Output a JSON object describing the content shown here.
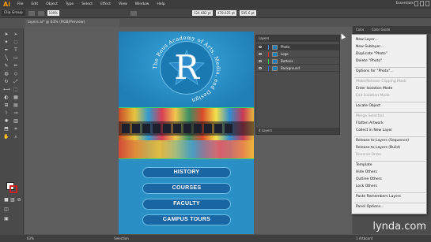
{
  "app": {
    "logo": "Ai",
    "menus": [
      "File",
      "Edit",
      "Object",
      "Type",
      "Select",
      "Effect",
      "View",
      "Window",
      "Help"
    ],
    "workspace": "Essentials"
  },
  "control_bar": {
    "selection_label": "Clip Group",
    "opacity": "100%",
    "x": "524.682 pt",
    "y": "478.025 pt",
    "w": "585.6 pt"
  },
  "document": {
    "tab_title": "layers.ai* @ 63% (RGB/Preview)",
    "zoom": "63%",
    "status_tool": "Selection"
  },
  "artwork": {
    "logo_letter": "R",
    "logo_ring_text": "The Rous Academy of Arts, Media, and Design",
    "buttons": [
      "HISTORY",
      "COURSES",
      "FACULTY",
      "CAMPUS TOURS"
    ],
    "button_color": "#1966a4",
    "background_color": "#2a8fc4"
  },
  "layers_panel": {
    "title": "Layers",
    "layers": [
      {
        "name": "Photo",
        "color": "#4f8ff5",
        "active": true
      },
      {
        "name": "Logo",
        "color": "#e23434",
        "active": false
      },
      {
        "name": "Buttons",
        "color": "#3cc24f",
        "active": false
      },
      {
        "name": "Background",
        "color": "#3a6cf0",
        "active": false
      }
    ],
    "footer": "4 Layers"
  },
  "color_panel": {
    "tabs": [
      "Color",
      "Color Guide"
    ]
  },
  "flyout_menu": {
    "items": [
      {
        "label": "New Layer...",
        "enabled": true
      },
      {
        "label": "New Sublayer...",
        "enabled": true
      },
      {
        "label": "Duplicate \"Photo\"",
        "enabled": true
      },
      {
        "label": "Delete \"Photo\"",
        "enabled": true
      },
      {
        "label": "Options for \"Photo\"...",
        "enabled": true
      },
      {
        "label": "Make/Release Clipping Mask",
        "enabled": false
      },
      {
        "label": "Enter Isolation Mode",
        "enabled": true
      },
      {
        "label": "Exit Isolation Mode",
        "enabled": false
      },
      {
        "label": "Locate Object",
        "enabled": true
      },
      {
        "label": "Merge Selected",
        "enabled": false
      },
      {
        "label": "Flatten Artwork",
        "enabled": true
      },
      {
        "label": "Collect in New Layer",
        "enabled": true
      },
      {
        "label": "Release to Layers (Sequence)",
        "enabled": true
      },
      {
        "label": "Release to Layers (Build)",
        "enabled": true
      },
      {
        "label": "Reverse Order",
        "enabled": false
      },
      {
        "label": "Template",
        "enabled": true
      },
      {
        "label": "Hide Others",
        "enabled": true
      },
      {
        "label": "Outline Others",
        "enabled": true
      },
      {
        "label": "Lock Others",
        "enabled": true
      },
      {
        "label": "Paste Remembers Layers",
        "enabled": true
      },
      {
        "label": "Panel Options...",
        "enabled": true
      }
    ]
  },
  "status": {
    "artboard": "1 Artboard"
  },
  "watermark": "lynda.com"
}
